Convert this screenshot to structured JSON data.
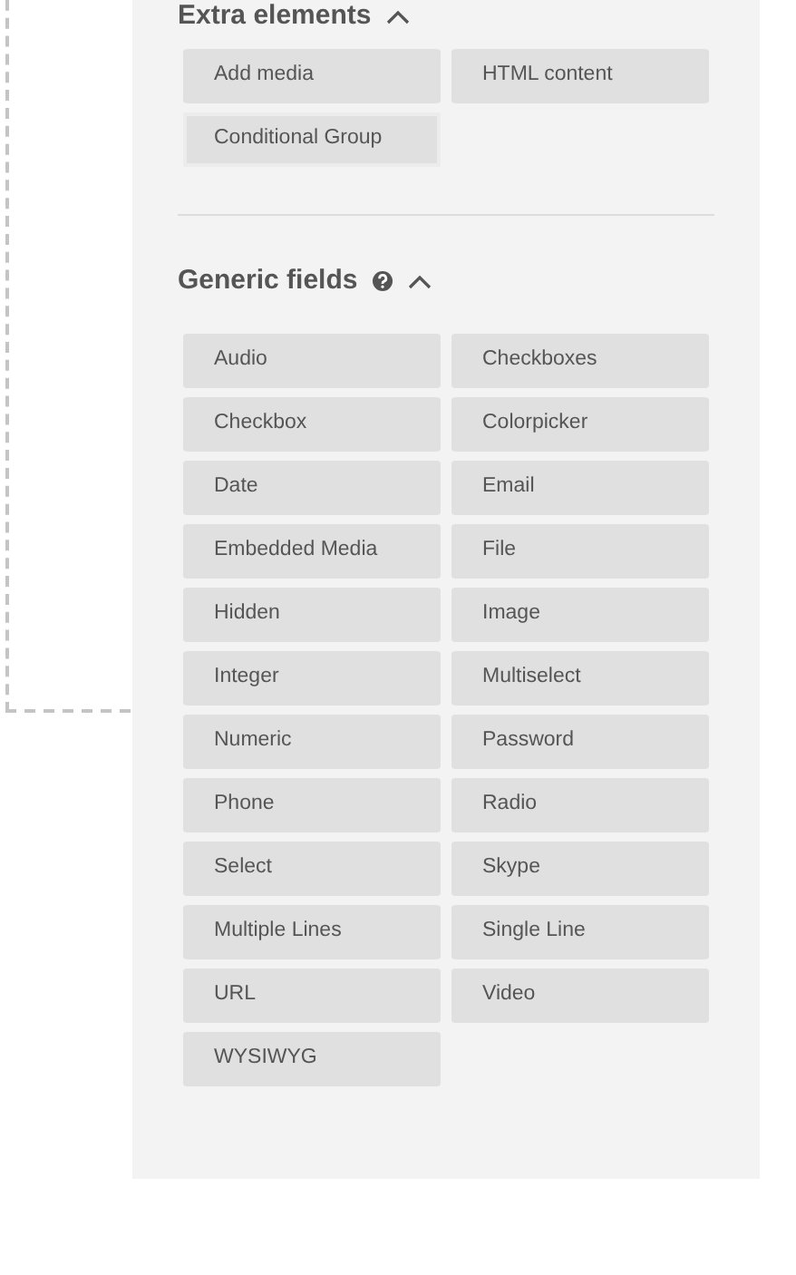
{
  "sections": [
    {
      "title": "Extra elements",
      "help": false,
      "expanded": true,
      "items": [
        {
          "label": "Add media",
          "highlighted": false
        },
        {
          "label": "HTML content",
          "highlighted": false
        },
        {
          "label": "Conditional Group",
          "highlighted": true
        }
      ]
    },
    {
      "title": "Generic fields",
      "help": true,
      "expanded": true,
      "items": [
        {
          "label": "Audio",
          "highlighted": false
        },
        {
          "label": "Checkboxes",
          "highlighted": false
        },
        {
          "label": "Checkbox",
          "highlighted": false
        },
        {
          "label": "Colorpicker",
          "highlighted": false
        },
        {
          "label": "Date",
          "highlighted": false
        },
        {
          "label": "Email",
          "highlighted": false
        },
        {
          "label": "Embedded Media",
          "highlighted": false
        },
        {
          "label": "File",
          "highlighted": false
        },
        {
          "label": "Hidden",
          "highlighted": false
        },
        {
          "label": "Image",
          "highlighted": false
        },
        {
          "label": "Integer",
          "highlighted": false
        },
        {
          "label": "Multiselect",
          "highlighted": false
        },
        {
          "label": "Numeric",
          "highlighted": false
        },
        {
          "label": "Password",
          "highlighted": false
        },
        {
          "label": "Phone",
          "highlighted": false
        },
        {
          "label": "Radio",
          "highlighted": false
        },
        {
          "label": "Select",
          "highlighted": false
        },
        {
          "label": "Skype",
          "highlighted": false
        },
        {
          "label": "Multiple Lines",
          "highlighted": false
        },
        {
          "label": "Single Line",
          "highlighted": false
        },
        {
          "label": "URL",
          "highlighted": false
        },
        {
          "label": "Video",
          "highlighted": false
        },
        {
          "label": "WYSIWYG",
          "highlighted": false
        }
      ]
    }
  ]
}
